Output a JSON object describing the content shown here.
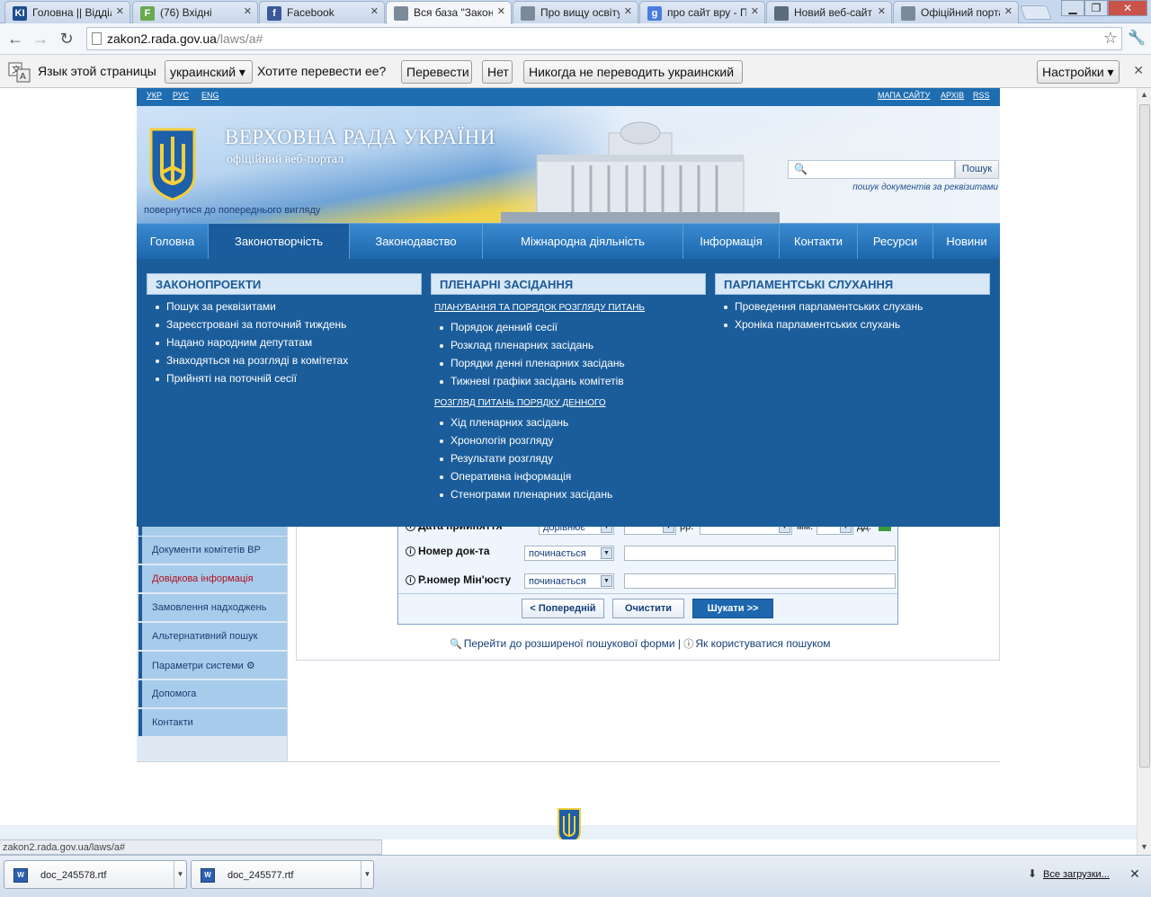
{
  "browser": {
    "tabs": [
      {
        "label": "Головна || Відділ",
        "icon_text": "KI",
        "icon_color": "#1c4e8e"
      },
      {
        "label": "(76) Вхідні",
        "icon_text": "F",
        "icon_color": "#6aa84f"
      },
      {
        "label": "Facebook",
        "icon_text": "f",
        "icon_color": "#3b5998"
      },
      {
        "label": "Вся база \"Законо",
        "icon_text": "",
        "icon_color": "#7a8a99"
      },
      {
        "label": "Про вищу освіту",
        "icon_text": "",
        "icon_color": "#7a8a99"
      },
      {
        "label": "про сайт вру - По",
        "icon_text": "g",
        "icon_color": "#4a7de0"
      },
      {
        "label": "Новий веб-сайт В",
        "icon_text": "",
        "icon_color": "#5b6b7c"
      },
      {
        "label": "Офіційний порта",
        "icon_text": "",
        "icon_color": "#7a8a99"
      }
    ],
    "url_host": "zakon2.rada.gov.ua",
    "url_path": "/laws/a#",
    "status_url": "zakon2.rada.gov.ua/laws/a#"
  },
  "translate_bar": {
    "page_language_text": "Язык этой страницы",
    "language_value": "украинский",
    "question": "Хотите перевести ее?",
    "translate_label": "Перевести",
    "no_label": "Нет",
    "never_label": "Никогда не переводить украинский",
    "settings_label": "Настройки"
  },
  "site": {
    "lang_links": [
      "УКР",
      "РУС",
      "ENG"
    ],
    "top_links": [
      "МАПА САЙТУ",
      "АРХІВ",
      "RSS"
    ],
    "title": "ВЕРХОВНА РАДА УКРАЇНИ",
    "subtitle": "офіційний веб-портал",
    "back_link": "повернутися до попереднього вигляду",
    "search_button": "Пошук",
    "search_requisites": "пошук документів за реквізитами"
  },
  "mainnav": [
    "Головна",
    "Законотворчість",
    "Законодавство",
    "Міжнародна діяльність",
    "Інформація",
    "Контакти",
    "Ресурси",
    "Новини"
  ],
  "dropdown": {
    "col1": {
      "title": "ЗАКОНОПРОЕКТИ",
      "items": [
        "Пошук за реквізитами",
        "Зареєстровані за поточний тиждень",
        "Надано народним депутатам",
        "Знаходяться на розгляді в комітетах",
        "Прийняті на поточній сесії"
      ]
    },
    "col2": {
      "title": "ПЛЕНАРНІ ЗАСІДАННЯ",
      "sub1": "ПЛАНУВАННЯ ТА ПОРЯДОК РОЗГЛЯДУ ПИТАНЬ",
      "items1": [
        "Порядок денний сесії",
        "Розклад пленарних засідань",
        "Порядки денні пленарних засідань",
        "Тижневі графіки засідань комітетів"
      ],
      "sub2": "РОЗГЛЯД ПИТАНЬ ПОРЯДКУ ДЕННОГО",
      "items2": [
        "Хід пленарних засідань",
        "Хронологія розгляду",
        "Результати розгляду",
        "Оперативна інформація",
        "Стенограми пленарних засідань"
      ]
    },
    "col3": {
      "title": "ПАРЛАМЕНТСЬКІ СЛУХАННЯ",
      "items": [
        "Проведення парламентських слухань",
        "Хроніка парламентських слухань"
      ]
    }
  },
  "leftmenu": [
    {
      "label": "Документи комітетів ВР"
    },
    {
      "label": "Довідкова інформація"
    },
    {
      "label": "Замовлення надходжень"
    },
    {
      "label": "Альтернативний пошук"
    },
    {
      "label": "Параметри системи ⚙"
    },
    {
      "label": "Допомога"
    },
    {
      "label": "Контакти"
    }
  ],
  "form": {
    "row0_label": "Дата прийняття",
    "row0_select": "дорівнює",
    "row0_unit_year": "рр.",
    "row0_unit_month": "мм.",
    "row0_unit_day": "дд.",
    "row1_label": "Номер док-та",
    "row1_select": "починається",
    "row2_label": "Р.номер Мін'юсту",
    "row2_select": "починається",
    "btn_prev": "< Попередній",
    "btn_clear": "Очистити",
    "btn_search": "Шукати >>",
    "link_advanced": "Перейти до розширеної пошукової форми",
    "separator": "|",
    "link_howto": "Як користуватися пошуком"
  },
  "downloads": {
    "items": [
      "doc_245578.rtf",
      "doc_245577.rtf"
    ],
    "all_label": "Все загрузки..."
  }
}
